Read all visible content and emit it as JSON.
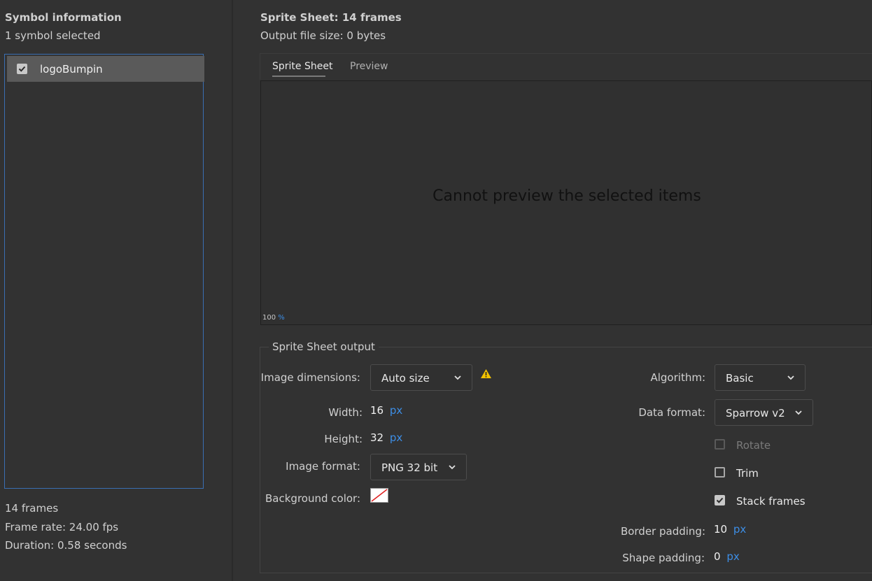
{
  "symbol_panel": {
    "heading": "Symbol information",
    "selected_count": "1 symbol selected",
    "symbols": [
      {
        "name": "logoBumpin",
        "checked": true
      }
    ],
    "frames": "14 frames",
    "frame_rate": "Frame rate: 24.00 fps",
    "duration": "Duration: 0.58 seconds"
  },
  "sheet_header": {
    "title": "Sprite Sheet: 14 frames",
    "file_size": "Output file size: 0 bytes"
  },
  "tabs": [
    {
      "label": "Sprite Sheet",
      "active": true
    },
    {
      "label": "Preview",
      "active": false
    }
  ],
  "preview": {
    "message": "Cannot preview the selected items",
    "zoom_value": "100",
    "zoom_unit": "%"
  },
  "output": {
    "legend": "Sprite Sheet output",
    "image_dimensions": {
      "label": "Image dimensions:",
      "value": "Auto size"
    },
    "warning_icon": "warning-triangle-icon",
    "width": {
      "label": "Width:",
      "value": "16",
      "unit": "px"
    },
    "height": {
      "label": "Height:",
      "value": "32",
      "unit": "px"
    },
    "image_format": {
      "label": "Image format:",
      "value": "PNG 32 bit"
    },
    "background_color": {
      "label": "Background color:",
      "value": "none"
    },
    "algorithm": {
      "label": "Algorithm:",
      "value": "Basic"
    },
    "data_format": {
      "label": "Data format:",
      "value": "Sparrow v2"
    },
    "rotate": {
      "label": "Rotate",
      "checked": false,
      "enabled": false
    },
    "trim": {
      "label": "Trim",
      "checked": false,
      "enabled": true
    },
    "stack_frames": {
      "label": "Stack frames",
      "checked": true,
      "enabled": true
    },
    "border_padding": {
      "label": "Border padding:",
      "value": "10",
      "unit": "px"
    },
    "shape_padding": {
      "label": "Shape padding:",
      "value": "0",
      "unit": "px"
    }
  },
  "colors": {
    "background": "#323232",
    "selection": "#5a5a5a",
    "focus_border": "#3a6fb3",
    "link_blue": "#3d8ee6",
    "warning": "#f2c200"
  }
}
